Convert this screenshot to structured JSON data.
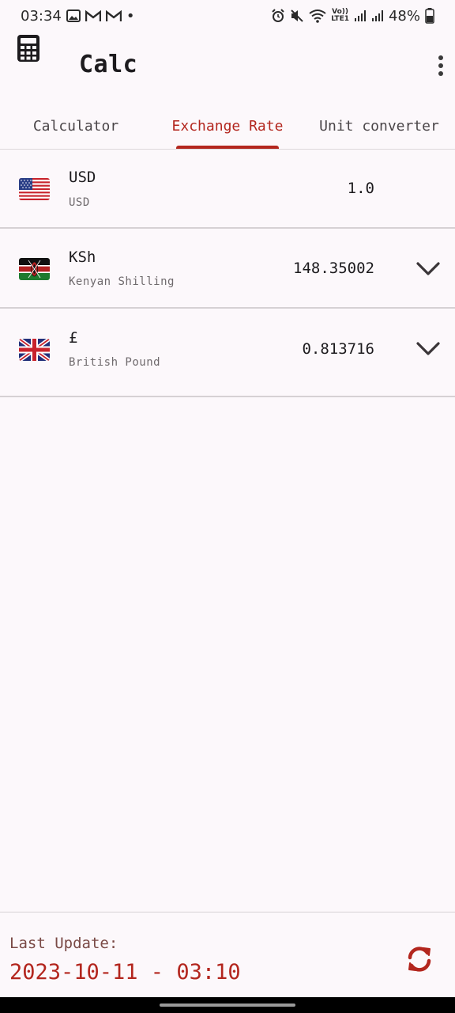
{
  "status_bar": {
    "time": "03:34",
    "dot": "•",
    "network_label": "LTE1",
    "volte_label": "Vo))",
    "battery": "48%"
  },
  "app_bar": {
    "title": "Calc",
    "icon": "calculator-icon",
    "menu_icon": "more-vert-icon"
  },
  "tabs": [
    {
      "label": "Calculator",
      "active": false
    },
    {
      "label": "Exchange Rate",
      "active": true
    },
    {
      "label": "Unit converter",
      "active": false
    }
  ],
  "currencies": [
    {
      "flag": "us-flag-icon",
      "symbol": "USD",
      "name": "USD",
      "value": "1.0",
      "has_dropdown": false
    },
    {
      "flag": "kenya-flag-icon",
      "symbol": "KSh",
      "name": "Kenyan Shilling",
      "value": "148.35002",
      "has_dropdown": true
    },
    {
      "flag": "uk-flag-icon",
      "symbol": "£",
      "name": "British Pound",
      "value": "0.813716",
      "has_dropdown": true
    }
  ],
  "footer": {
    "last_update_label": "Last Update:",
    "last_update_value": "2023-10-11 - 03:10",
    "refresh_icon": "refresh-icon"
  },
  "colors": {
    "accent": "#b3261e",
    "background": "#fcf8fb"
  }
}
